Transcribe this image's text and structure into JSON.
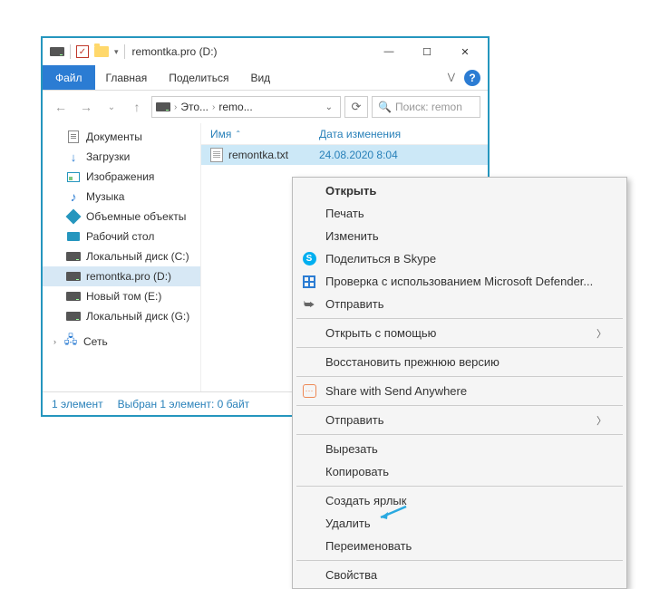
{
  "titlebar": {
    "title": "remontka.pro (D:)"
  },
  "tabs": {
    "file": "Файл",
    "home": "Главная",
    "share": "Поделиться",
    "view": "Вид"
  },
  "address": {
    "seg1": "Это...",
    "seg2": "remo..."
  },
  "search": {
    "placeholder": "Поиск: remon"
  },
  "sidebar": {
    "documents": "Документы",
    "downloads": "Загрузки",
    "pictures": "Изображения",
    "music": "Музыка",
    "objects3d": "Объемные объекты",
    "desktop": "Рабочий стол",
    "diskC": "Локальный диск (C:)",
    "diskD": "remontka.pro (D:)",
    "diskE": "Новый том (E:)",
    "diskG": "Локальный диск (G:)",
    "network": "Сеть"
  },
  "columns": {
    "name": "Имя",
    "date": "Дата изменения"
  },
  "file": {
    "name": "remontka.txt",
    "date": "24.08.2020 8:04"
  },
  "status": {
    "count": "1 элемент",
    "selected": "Выбран 1 элемент: 0 байт"
  },
  "ctx": {
    "open": "Открыть",
    "print": "Печать",
    "edit": "Изменить",
    "skype": "Поделиться в Skype",
    "defender": "Проверка с использованием Microsoft Defender...",
    "sendto1": "Отправить",
    "openwith": "Открыть с помощью",
    "restore": "Восстановить прежнюю версию",
    "sendanywhere": "Share with Send Anywhere",
    "sendto2": "Отправить",
    "cut": "Вырезать",
    "copy": "Копировать",
    "shortcut": "Создать ярлык",
    "delete": "Удалить",
    "rename": "Переименовать",
    "properties": "Свойства"
  }
}
